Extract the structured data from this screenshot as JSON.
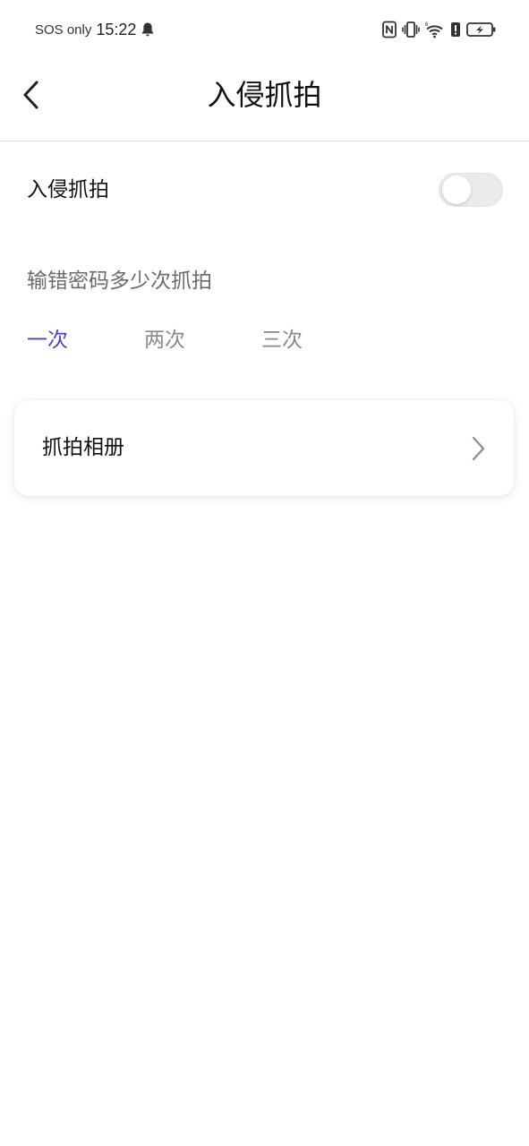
{
  "status_bar": {
    "carrier_text": "SOS only",
    "time": "15:22",
    "icons": [
      "bell-icon",
      "nfc-icon",
      "vibrate-icon",
      "wifi-icon",
      "alert-icon",
      "battery-charging-icon"
    ]
  },
  "header": {
    "title": "入侵抓拍",
    "back_icon": "chevron-left-icon"
  },
  "toggle": {
    "label": "入侵抓拍",
    "enabled": false
  },
  "attempts": {
    "label": "输错密码多少次抓拍",
    "options": [
      "一次",
      "两次",
      "三次"
    ],
    "selected_index": 0
  },
  "album": {
    "label": "抓拍相册",
    "icon": "chevron-right-icon"
  },
  "colors": {
    "accent": "#4a3fd6",
    "toggle_off": "#ebebeb",
    "muted_text": "#8a8a8a"
  }
}
